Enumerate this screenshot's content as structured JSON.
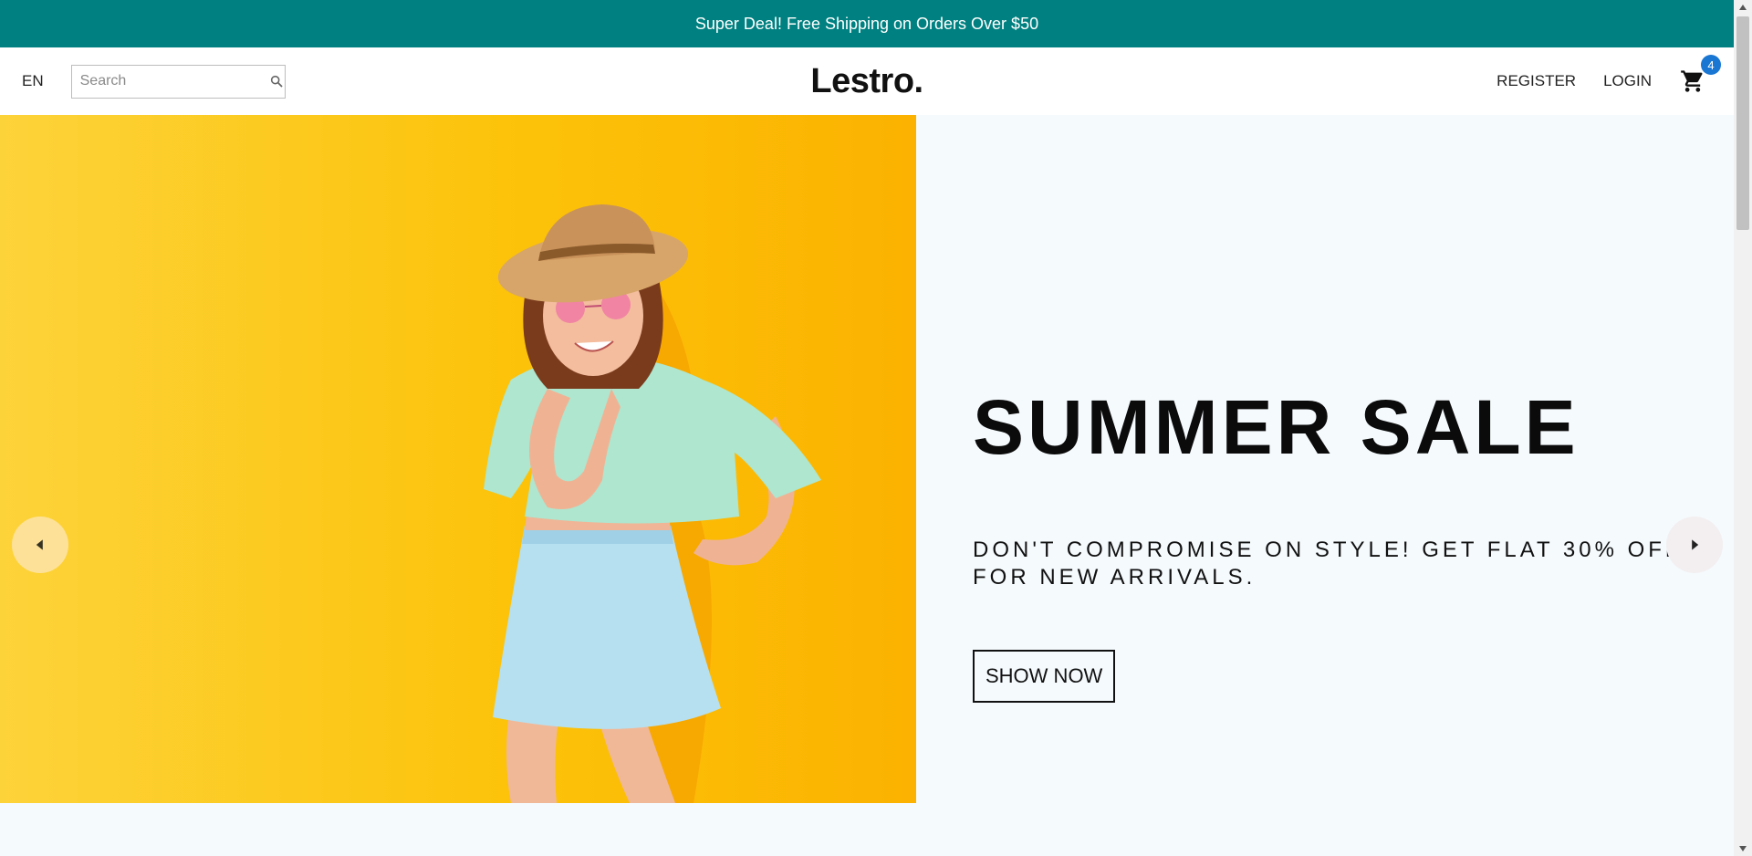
{
  "announcement": {
    "text": "Super Deal! Free Shipping on Orders Over $50",
    "background": "#008080"
  },
  "navbar": {
    "language": "EN",
    "search": {
      "placeholder": "Search",
      "value": "",
      "icon": "search-icon"
    },
    "logo": "Lestro.",
    "menu": {
      "register": "REGISTER",
      "login": "LOGIN"
    },
    "cart": {
      "icon": "shopping-cart-icon",
      "badge_count": "4",
      "badge_color": "#1976d2"
    }
  },
  "slider": {
    "slide": {
      "title": "SUMMER SALE",
      "description": "DON'T COMPROMISE ON STYLE! GET FLAT 30% OFF FOR NEW ARRIVALS.",
      "button_label": "SHOW NOW",
      "image": "woman-in-straw-hat-on-yellow-background",
      "background": "#f5fafd"
    },
    "prev_icon": "arrow-left-icon",
    "next_icon": "arrow-right-icon"
  }
}
